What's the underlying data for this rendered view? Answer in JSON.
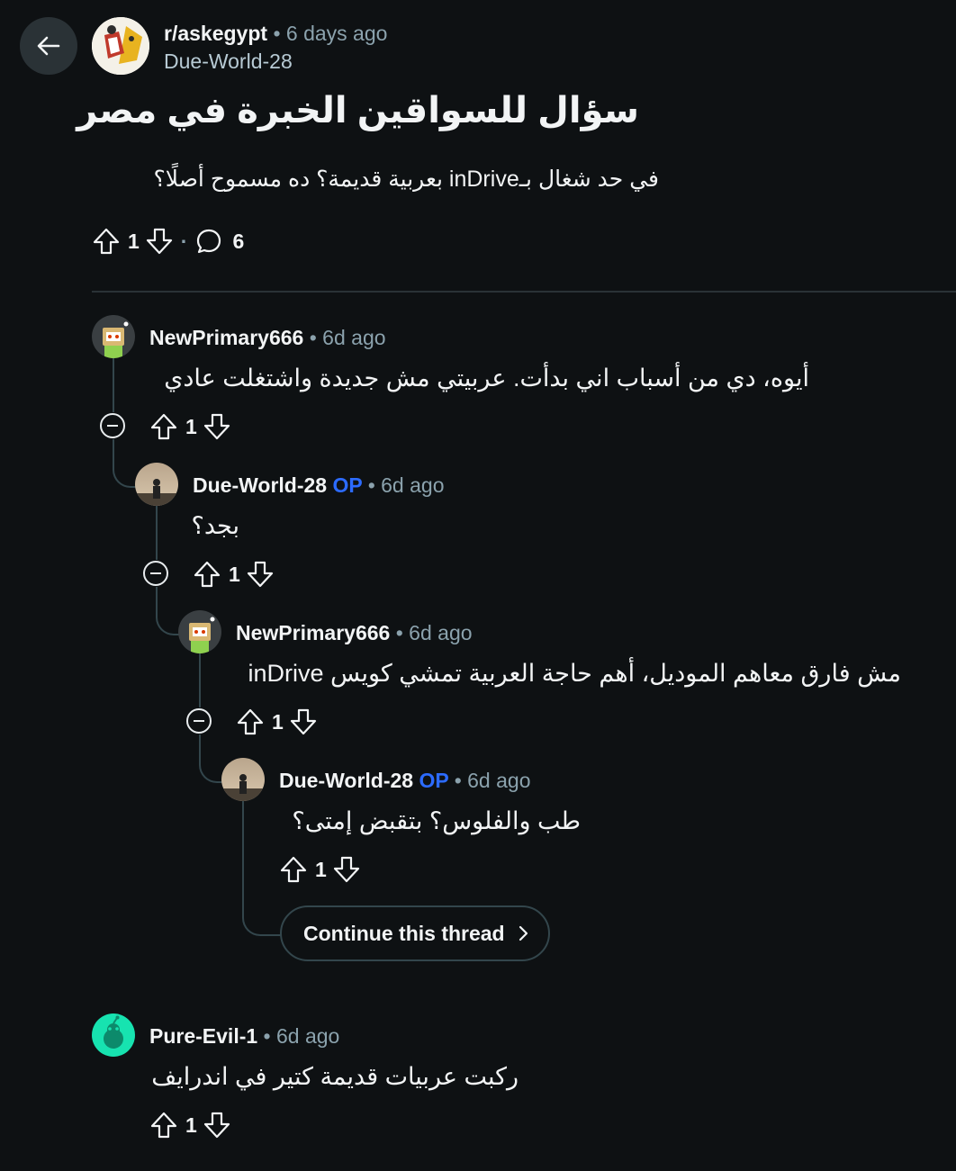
{
  "post": {
    "subreddit": "r/askegypt",
    "time": "• 6 days ago",
    "author": "Due-World-28",
    "title": "سؤال للسواقين الخبرة في مصر",
    "body": "في حد شغال بـinDrive بعربية قديمة؟ ده مسموح أصلًا؟",
    "score": "1",
    "comments_count": "6"
  },
  "comments": [
    {
      "author": "NewPrimary666",
      "op": "",
      "time": "• 6d ago",
      "body": "أيوه، دي من أسباب اني بدأت. عربيتي مش جديدة واشتغلت عادي",
      "score": "1"
    },
    {
      "author": "Due-World-28",
      "op": "OP",
      "time": "• 6d ago",
      "body": "بجد؟",
      "score": "1"
    },
    {
      "author": "NewPrimary666",
      "op": "",
      "time": "• 6d ago",
      "body": "مش فارق معاهم الموديل، أهم حاجة العربية تمشي كويس inDrive",
      "score": "1"
    },
    {
      "author": "Due-World-28",
      "op": "OP",
      "time": "• 6d ago",
      "body": "طب والفلوس؟ بتقبض إمتى؟",
      "score": "1"
    },
    {
      "author": "Pure-Evil-1",
      "op": "",
      "time": "• 6d ago",
      "body": "ركبت عربيات قديمة كتير في اندرايف",
      "score": "1"
    }
  ],
  "continue_thread": "Continue this thread",
  "colors": {
    "background": "#0e1113",
    "op": "#2c6bff",
    "meta": "#8ba2ad",
    "thread_line": "#33464c"
  }
}
